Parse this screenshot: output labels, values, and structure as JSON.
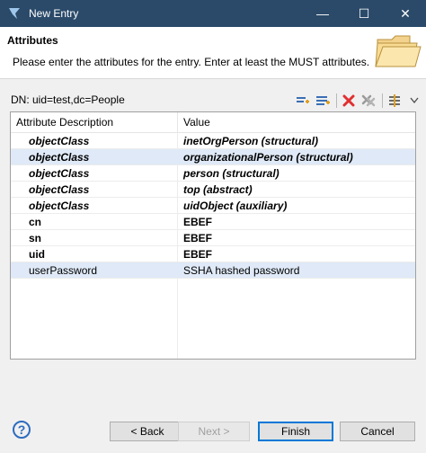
{
  "window": {
    "title": "New Entry",
    "minimize": "—",
    "maximize": "☐",
    "close": "✕"
  },
  "header": {
    "title": "Attributes",
    "description": "Please enter the attributes for the entry. Enter at least the MUST attributes."
  },
  "dn": {
    "label": "DN: uid=test,dc=People"
  },
  "table": {
    "columns": [
      "Attribute Description",
      "Value"
    ],
    "rows": [
      {
        "attr": "objectClass",
        "value": "inetOrgPerson (structural)"
      },
      {
        "attr": "objectClass",
        "value": "organizationalPerson (structural)"
      },
      {
        "attr": "objectClass",
        "value": "person (structural)"
      },
      {
        "attr": "objectClass",
        "value": "top (abstract)"
      },
      {
        "attr": "objectClass",
        "value": "uidObject (auxiliary)"
      },
      {
        "attr": "cn",
        "value": "EBEF"
      },
      {
        "attr": "sn",
        "value": "EBEF"
      },
      {
        "attr": "uid",
        "value": "EBEF"
      },
      {
        "attr": "userPassword",
        "value": "SSHA hashed password"
      }
    ]
  },
  "footer": {
    "help": "?",
    "back": "< Back",
    "next": "Next >",
    "finish": "Finish",
    "cancel": "Cancel"
  },
  "colors": {
    "titlebar": "#2b4a6a",
    "selected_row": "#dfe9f7",
    "delete_red": "#e03030",
    "primary_border": "#0078d7"
  }
}
